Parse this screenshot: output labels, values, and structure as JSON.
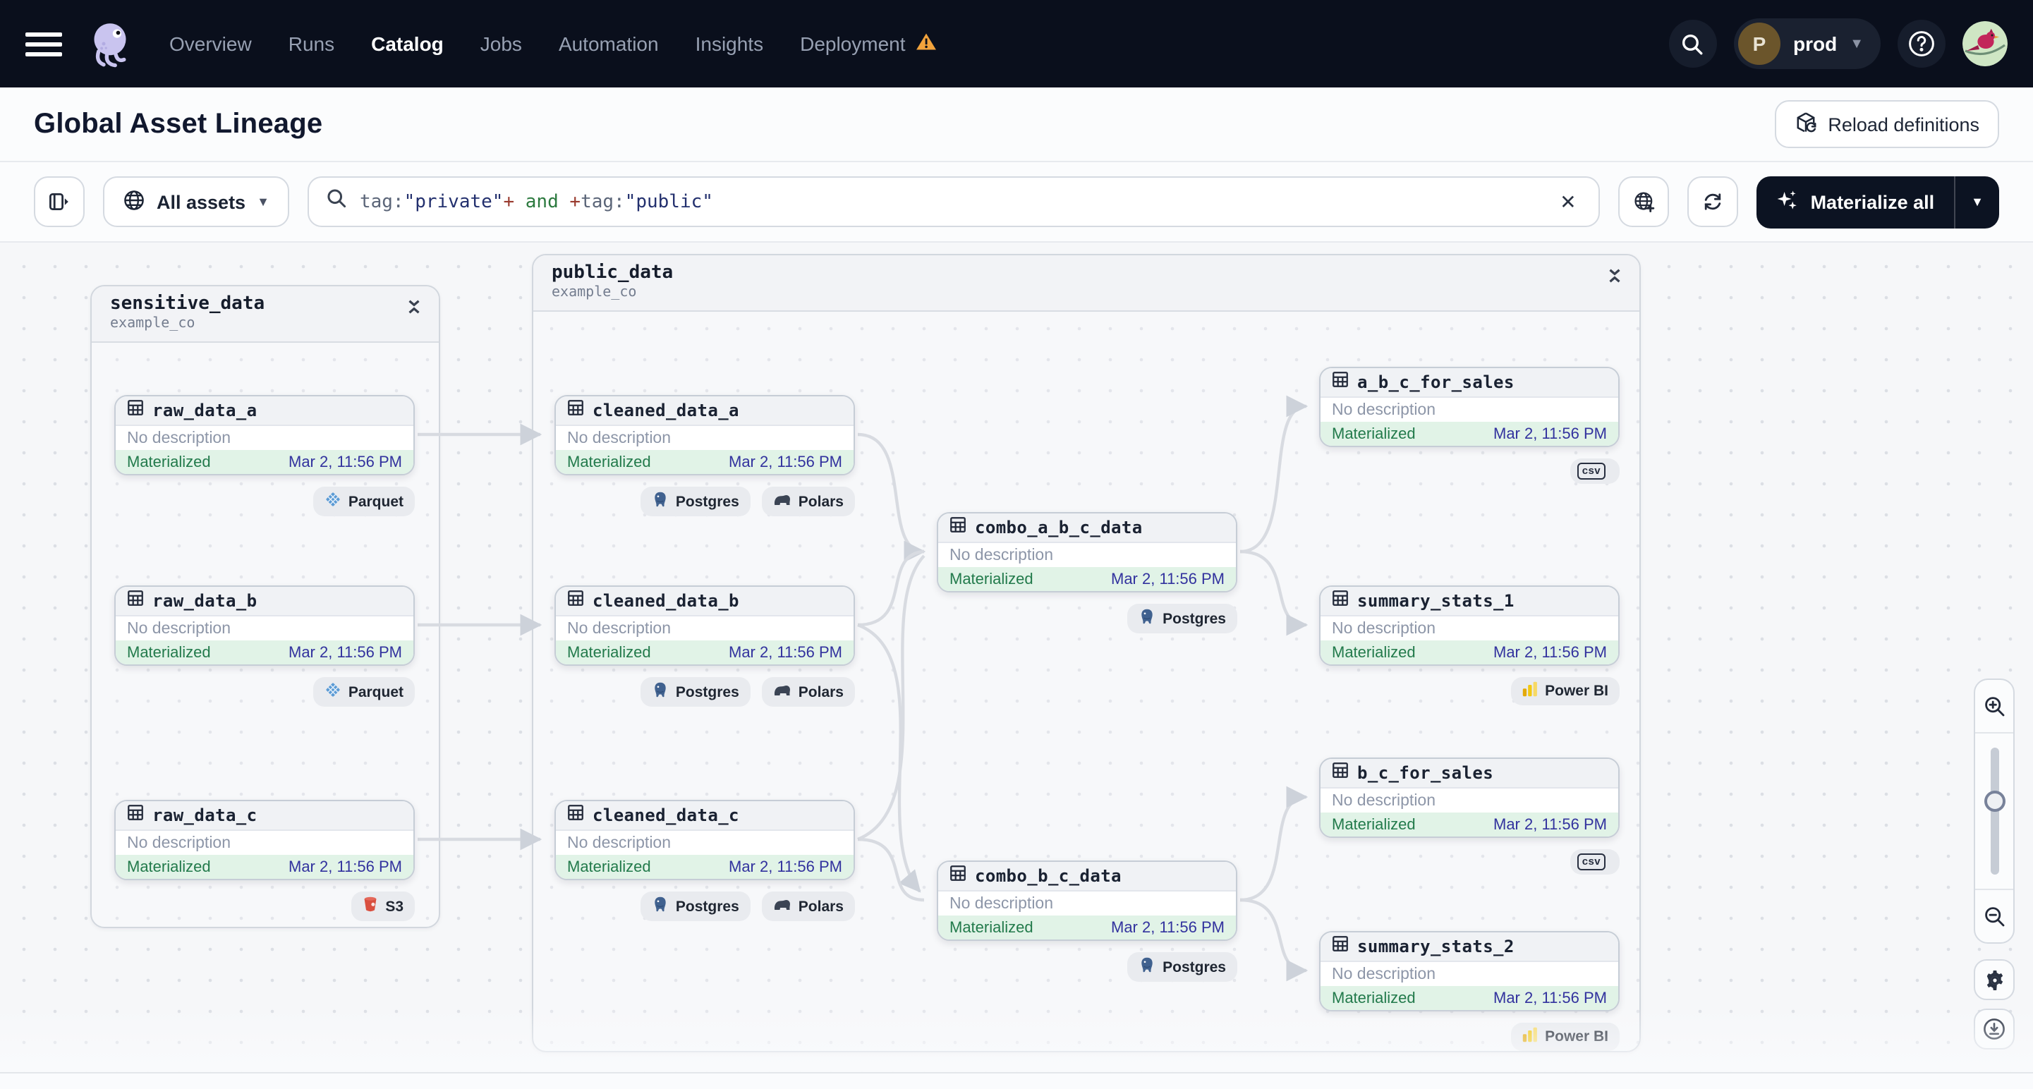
{
  "topbar": {
    "nav_items": [
      {
        "label": "Overview",
        "active": false
      },
      {
        "label": "Runs",
        "active": false
      },
      {
        "label": "Catalog",
        "active": true
      },
      {
        "label": "Jobs",
        "active": false
      },
      {
        "label": "Automation",
        "active": false
      },
      {
        "label": "Insights",
        "active": false
      },
      {
        "label": "Deployment",
        "active": false,
        "warning": true
      }
    ],
    "env_badge": {
      "initial": "P",
      "name": "prod"
    }
  },
  "page_header": {
    "title": "Global Asset Lineage",
    "reload_button": "Reload definitions"
  },
  "toolbar": {
    "scope_selector": "All assets",
    "query_segments": [
      {
        "text": "tag:",
        "type": "key"
      },
      {
        "text": "\"private\"",
        "type": "string"
      },
      {
        "text": "+",
        "type": "op"
      },
      {
        "text": " and ",
        "type": "bool"
      },
      {
        "text": "+",
        "type": "op"
      },
      {
        "text": "tag:",
        "type": "key"
      },
      {
        "text": "\"public\"",
        "type": "string"
      }
    ],
    "materialize_button": "Materialize all"
  },
  "graph": {
    "groups": [
      {
        "name": "sensitive_data",
        "location": "example_co"
      },
      {
        "name": "public_data",
        "location": "example_co"
      }
    ],
    "node_defaults": {
      "description": "No description",
      "status": "Materialized",
      "timestamp": "Mar 2, 11:56 PM"
    },
    "nodes": [
      {
        "name": "raw_data_a",
        "group": "sensitive_data",
        "tags": [
          {
            "label": "Parquet",
            "icon": "parquet-icon"
          }
        ]
      },
      {
        "name": "raw_data_b",
        "group": "sensitive_data",
        "tags": [
          {
            "label": "Parquet",
            "icon": "parquet-icon"
          }
        ]
      },
      {
        "name": "raw_data_c",
        "group": "sensitive_data",
        "tags": [
          {
            "label": "S3",
            "icon": "s3-icon"
          }
        ]
      },
      {
        "name": "cleaned_data_a",
        "group": "public_data",
        "tags": [
          {
            "label": "Postgres",
            "icon": "postgres-icon"
          },
          {
            "label": "Polars",
            "icon": "polars-icon"
          }
        ]
      },
      {
        "name": "cleaned_data_b",
        "group": "public_data",
        "tags": [
          {
            "label": "Postgres",
            "icon": "postgres-icon"
          },
          {
            "label": "Polars",
            "icon": "polars-icon"
          }
        ]
      },
      {
        "name": "cleaned_data_c",
        "group": "public_data",
        "tags": [
          {
            "label": "Postgres",
            "icon": "postgres-icon"
          },
          {
            "label": "Polars",
            "icon": "polars-icon"
          }
        ]
      },
      {
        "name": "combo_a_b_c_data",
        "group": "public_data",
        "tags": [
          {
            "label": "Postgres",
            "icon": "postgres-icon"
          }
        ]
      },
      {
        "name": "combo_b_c_data",
        "group": "public_data",
        "tags": [
          {
            "label": "Postgres",
            "icon": "postgres-icon"
          }
        ]
      },
      {
        "name": "a_b_c_for_sales",
        "group": "public_data",
        "tags": [
          {
            "label": "",
            "icon": "csv-icon"
          }
        ]
      },
      {
        "name": "summary_stats_1",
        "group": "public_data",
        "tags": [
          {
            "label": "Power BI",
            "icon": "powerbi-icon"
          }
        ]
      },
      {
        "name": "b_c_for_sales",
        "group": "public_data",
        "tags": [
          {
            "label": "",
            "icon": "csv-icon"
          }
        ]
      },
      {
        "name": "summary_stats_2",
        "group": "public_data",
        "tags": [
          {
            "label": "Power BI",
            "icon": "powerbi-icon"
          }
        ]
      }
    ]
  },
  "colors": {
    "topbar_bg": "#0a0f1c",
    "nav_active": "#ffffff",
    "nav_inactive": "#97a0b2",
    "warning": "#f2a33c",
    "status_text": "#227a4b",
    "status_bg": "#e1f3e7",
    "timestamp_text": "#32329e",
    "edge": "#d8dbe1",
    "materialize_bg": "#0c1322",
    "query_key": "#5b6578",
    "query_string": "#23306e",
    "query_op": "#993a2e",
    "query_bool": "#2c7a3f"
  }
}
